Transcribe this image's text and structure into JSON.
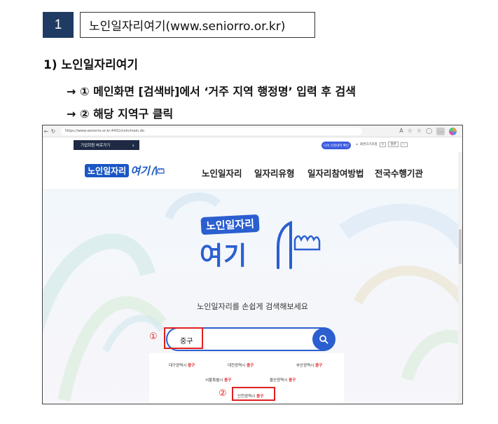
{
  "header": {
    "number": "1",
    "title": "노인일자리여기(www.seniorro.or.kr)"
  },
  "section": {
    "heading": "1) 노인일자리여기",
    "steps": [
      "→ ① 메인화면 [검색바]에서 ‘거주 지역 행정명’ 입력 후 검색",
      "→ ② 해당 지역구 클릭"
    ]
  },
  "screenshot": {
    "browser": {
      "url": "https://www.seniorro.or.kr:4431/noin/main.do"
    },
    "top_strip": {
      "biz_button": "기업회원 바로가기",
      "my_button": "나의 신청내역 확인",
      "util": [
        "화면크기조정",
        "+",
        "원본",
        "−"
      ]
    },
    "nav": {
      "logo_text_1": "노인일자리",
      "logo_text_2": "여기",
      "menu": [
        "노인일자리",
        "일자리유형",
        "일자리참여방법",
        "전국수행기관"
      ]
    },
    "hero": {
      "logo_text_1": "노인일자리",
      "logo_text_2": "여기",
      "slogan": "노인일자리를 손쉽게 검색해보세요",
      "search_value": "중구",
      "marker_1": "①",
      "marker_2": "②"
    },
    "results": [
      {
        "city": "대구광역시",
        "gu": "중구"
      },
      {
        "city": "대전광역시",
        "gu": "중구"
      },
      {
        "city": "부산광역시",
        "gu": "중구"
      },
      {
        "city": "서울특별시",
        "gu": "중구"
      },
      {
        "city": "울산광역시",
        "gu": "중구"
      },
      {
        "city": "인천광역시",
        "gu": "중구"
      }
    ],
    "colors": {
      "brand_blue": "#2b5fd0",
      "highlight_red": "#e02020",
      "header_box": "#1f3b63"
    }
  }
}
